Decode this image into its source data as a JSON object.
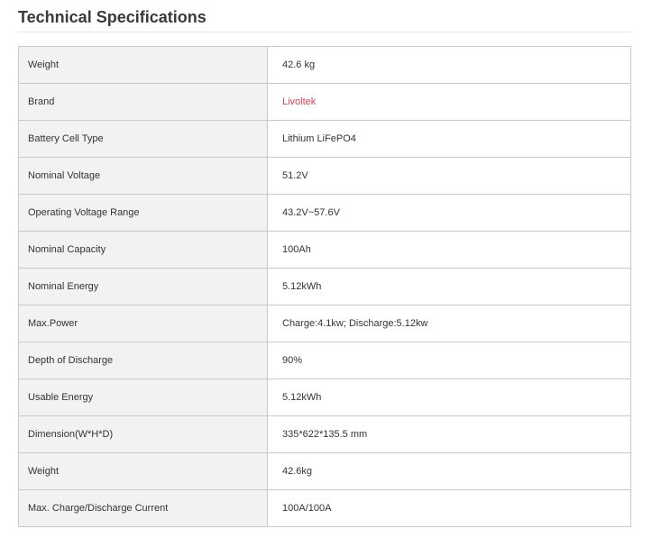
{
  "section": {
    "title": "Technical Specifications"
  },
  "colors": {
    "brand_link": "#d9434f",
    "label_background": "#f2f2f2",
    "border": "#c8c8c8"
  },
  "specs": [
    {
      "label": "Weight",
      "value": "42.6 kg"
    },
    {
      "label": "Brand",
      "value": "Livoltek",
      "is_link": true
    },
    {
      "label": "Battery Cell Type",
      "value": "Lithium LiFePO4"
    },
    {
      "label": "Nominal Voltage",
      "value": "51.2V"
    },
    {
      "label": "Operating Voltage Range",
      "value": "43.2V~57.6V"
    },
    {
      "label": "Nominal Capacity",
      "value": "100Ah"
    },
    {
      "label": "Nominal Energy",
      "value": "5.12kWh"
    },
    {
      "label": "Max.Power",
      "value": "Charge:4.1kw; Discharge:5.12kw"
    },
    {
      "label": "Depth of Discharge",
      "value": "90%"
    },
    {
      "label": "Usable Energy",
      "value": "5.12kWh"
    },
    {
      "label": "Dimension(W*H*D)",
      "value": "335*622*135.5 mm"
    },
    {
      "label": "Weight",
      "value": "42.6kg"
    },
    {
      "label": "Max. Charge/Discharge Current",
      "value": "100A/100A"
    }
  ]
}
